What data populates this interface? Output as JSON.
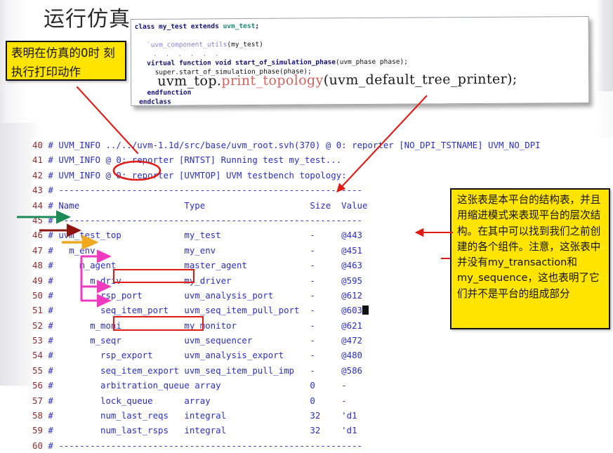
{
  "slide": {
    "title": "运行仿真"
  },
  "code_card": {
    "lines": [
      {
        "id": "l1",
        "segments": [
          {
            "t": "class ",
            "c": "kw"
          },
          {
            "t": "my_test ",
            "c": "kw"
          },
          {
            "t": "extends ",
            "c": "kw"
          },
          {
            "t": "uvm_test",
            "c": "type"
          },
          {
            "t": ";",
            "c": "kw"
          }
        ]
      },
      {
        "id": "l2",
        "segments": []
      },
      {
        "id": "l3",
        "segments": [
          {
            "t": "   `uvm_component_utils",
            "c": "macro"
          },
          {
            "t": "(my_test)",
            "c": "plain"
          }
        ]
      },
      {
        "id": "l4",
        "segments": [
          {
            "t": "   . . . . . .",
            "c": "dots"
          }
        ]
      },
      {
        "id": "l5",
        "segments": [
          {
            "t": "   virtual function void start_of_simulation_phase",
            "c": "kw"
          },
          {
            "t": "(uvm_phase phase);",
            "c": "plain"
          }
        ]
      },
      {
        "id": "l6",
        "segments": [
          {
            "t": "     super.start_of_simulation_phase(phase);",
            "c": "plain"
          }
        ]
      },
      {
        "id": "l7",
        "segments": [
          {
            "t": "     uvm_top.",
            "c": "big"
          },
          {
            "t": "print_topology",
            "c": "bigred"
          },
          {
            "t": "(uvm_default_tree_printer);",
            "c": "big"
          }
        ]
      },
      {
        "id": "l8",
        "segments": [
          {
            "t": "   endfunction",
            "c": "kw"
          }
        ]
      },
      {
        "id": "l9",
        "segments": [
          {
            "t": " endclass",
            "c": "kw"
          }
        ]
      }
    ]
  },
  "terminal": {
    "rows": [
      {
        "num": "40",
        "hash": "#",
        "text": " UVM_INFO ../../uvm-1.1d/src/base/uvm_root.svh(370) @ 0: reporter [NO_DPI_TSTNAME] UVM_NO_DPI"
      },
      {
        "num": "41",
        "hash": "#",
        "text": " UVM_INFO @ 0: reporter [RNTST] Running test my_test..."
      },
      {
        "num": "42",
        "hash": "#",
        "text": " UVM_INFO @ 0: reporter [UVMTOP] UVM testbench topology:"
      },
      {
        "num": "43",
        "hash": "#",
        "text": " ----------------------------------------------------------"
      },
      {
        "num": "44",
        "hash": "#",
        "text": " Name                    Type                    Size  Value"
      },
      {
        "num": "45",
        "hash": "#",
        "text": " ----------------------------------------------------------"
      },
      {
        "num": "46",
        "hash": "#",
        "text": " uvm_test_top            my_test                 -     @443"
      },
      {
        "num": "47",
        "hash": "#",
        "text": "   m_env                 my_env                  -     @451"
      },
      {
        "num": "48",
        "hash": "#",
        "text": "     m_agent             master_agent            -     @463"
      },
      {
        "num": "49",
        "hash": "#",
        "text": "       m_driv            my_driver               -     @595"
      },
      {
        "num": "50",
        "hash": "#",
        "text": "         rsp_port        uvm_analysis_port       -     @612"
      },
      {
        "num": "51",
        "hash": "#",
        "text": "         seq_item_port   uvm_seq_item_pull_port  -     @603"
      },
      {
        "num": "52",
        "hash": "#",
        "text": "       m_moni            my_monitor              -     @621"
      },
      {
        "num": "53",
        "hash": "#",
        "text": "       m_seqr            uvm_sequencer           -     @472"
      },
      {
        "num": "54",
        "hash": "#",
        "text": "         rsp_export      uvm_analysis_export     -     @480"
      },
      {
        "num": "55",
        "hash": "#",
        "text": "         seq_item_export uvm_seq_item_pull_imp   -     @586"
      },
      {
        "num": "56",
        "hash": "#",
        "text": "         arbitration_queue array                 0     -"
      },
      {
        "num": "57",
        "hash": "#",
        "text": "         lock_queue      array                   0     -"
      },
      {
        "num": "58",
        "hash": "#",
        "text": "         num_last_reqs   integral                32    'd1"
      },
      {
        "num": "59",
        "hash": "#",
        "text": "         num_last_rsps   integral                32    'd1"
      },
      {
        "num": "60",
        "hash": "#",
        "text": " ----------------------------------------------------------"
      }
    ],
    "table_headers": [
      "Name",
      "Type",
      "Size",
      "Value"
    ],
    "tree": [
      {
        "name": "uvm_test_top",
        "type": "my_test",
        "size": "-",
        "value": "@443"
      },
      {
        "name": "m_env",
        "type": "my_env",
        "size": "-",
        "value": "@451"
      },
      {
        "name": "m_agent",
        "type": "master_agent",
        "size": "-",
        "value": "@463"
      },
      {
        "name": "m_driv",
        "type": "my_driver",
        "size": "-",
        "value": "@595"
      },
      {
        "name": "rsp_port",
        "type": "uvm_analysis_port",
        "size": "-",
        "value": "@612"
      },
      {
        "name": "seq_item_port",
        "type": "uvm_seq_item_pull_port",
        "size": "-",
        "value": "@603"
      },
      {
        "name": "m_moni",
        "type": "my_monitor",
        "size": "-",
        "value": "@621"
      },
      {
        "name": "m_seqr",
        "type": "uvm_sequencer",
        "size": "-",
        "value": "@472"
      },
      {
        "name": "rsp_export",
        "type": "uvm_analysis_export",
        "size": "-",
        "value": "@480"
      },
      {
        "name": "seq_item_export",
        "type": "uvm_seq_item_pull_imp",
        "size": "-",
        "value": "@586"
      },
      {
        "name": "arbitration_queue",
        "type": "array",
        "size": "0",
        "value": "-"
      },
      {
        "name": "lock_queue",
        "type": "array",
        "size": "0",
        "value": "-"
      },
      {
        "name": "num_last_reqs",
        "type": "integral",
        "size": "32",
        "value": "'d1"
      },
      {
        "name": "num_last_rsps",
        "type": "integral",
        "size": "32",
        "value": "'d1"
      }
    ]
  },
  "callouts": {
    "left": "表明在仿真的0时\n刻执行打印动作",
    "right": "这张表是本平台的结构表，并且用缩进模式来表现平台的层次结构。在其中可以找到我们之前创建的各个组件。注意，这张表中并没有my_transaction和my_sequence，这也表明了它们并不是平台的组成部分"
  },
  "colors": {
    "callout_fill": "#ffe400",
    "annotation_red": "#e01b14",
    "arrow_green": "#1d8a55",
    "arrow_darkred": "#8e1410",
    "arrow_orange": "#f0a81e",
    "arrow_magenta": "#ee3bc0",
    "terminal_text": "#2b2fc8",
    "line_number": "#8f2b2b",
    "code_keyword": "#11107a",
    "code_type": "#1c8c7a",
    "code_macro": "#8e7fd0",
    "code_highlight": "#d4615e"
  }
}
